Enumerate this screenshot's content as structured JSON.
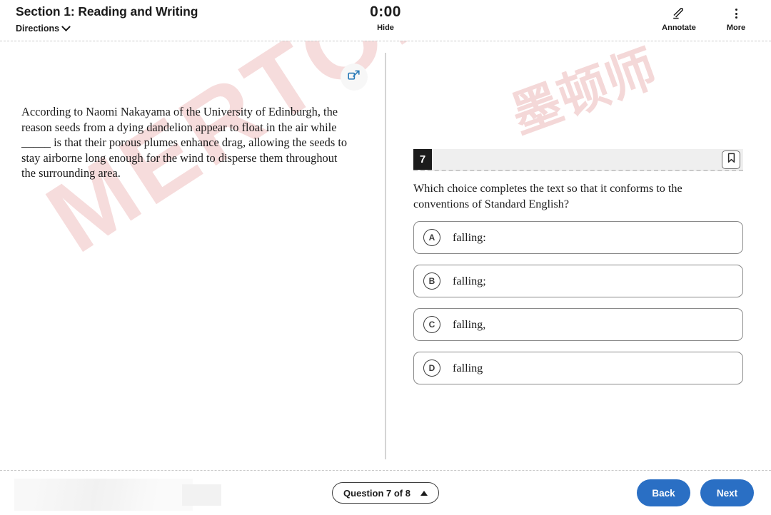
{
  "header": {
    "section_title": "Section 1: Reading and Writing",
    "directions_label": "Directions",
    "directions_icon": "chevron-down-icon",
    "timer": "0:00",
    "hide_label": "Hide",
    "annotate_label": "Annotate",
    "annotate_icon": "pen-underline-icon",
    "more_label": "More",
    "more_icon": "vertical-dots-icon"
  },
  "panels": {
    "expand_left_icon": "expand-panel-icon",
    "expand_right_icon": "collapse-panel-icon",
    "passage": "According to Naomi Nakayama of the University of Edinburgh, the reason seeds from a dying dandelion appear to float in the air while _____ is that their porous plumes enhance drag, allowing the seeds to stay airborne long enough for the wind to disperse them throughout the surrounding area."
  },
  "question": {
    "number": "7",
    "bookmark_icon": "bookmark-icon",
    "prompt": "Which choice completes the text so that it conforms to the conventions of Standard English?",
    "choices": [
      {
        "letter": "A",
        "text": "falling:"
      },
      {
        "letter": "B",
        "text": "falling;"
      },
      {
        "letter": "C",
        "text": "falling,"
      },
      {
        "letter": "D",
        "text": "falling"
      }
    ]
  },
  "footer": {
    "question_nav_label": "Question 7 of 8",
    "question_nav_icon": "triangle-up-icon",
    "back_label": "Back",
    "next_label": "Next"
  },
  "watermark": {
    "primary": "MERTON",
    "secondary": "墨顿师"
  },
  "colors": {
    "accent_blue": "#2a6fc4",
    "icon_blue": "#2a7ab8",
    "question_badge": "#1b1b1b",
    "strip_gray": "#efefef",
    "watermark_pink": "#f5d6d6"
  }
}
